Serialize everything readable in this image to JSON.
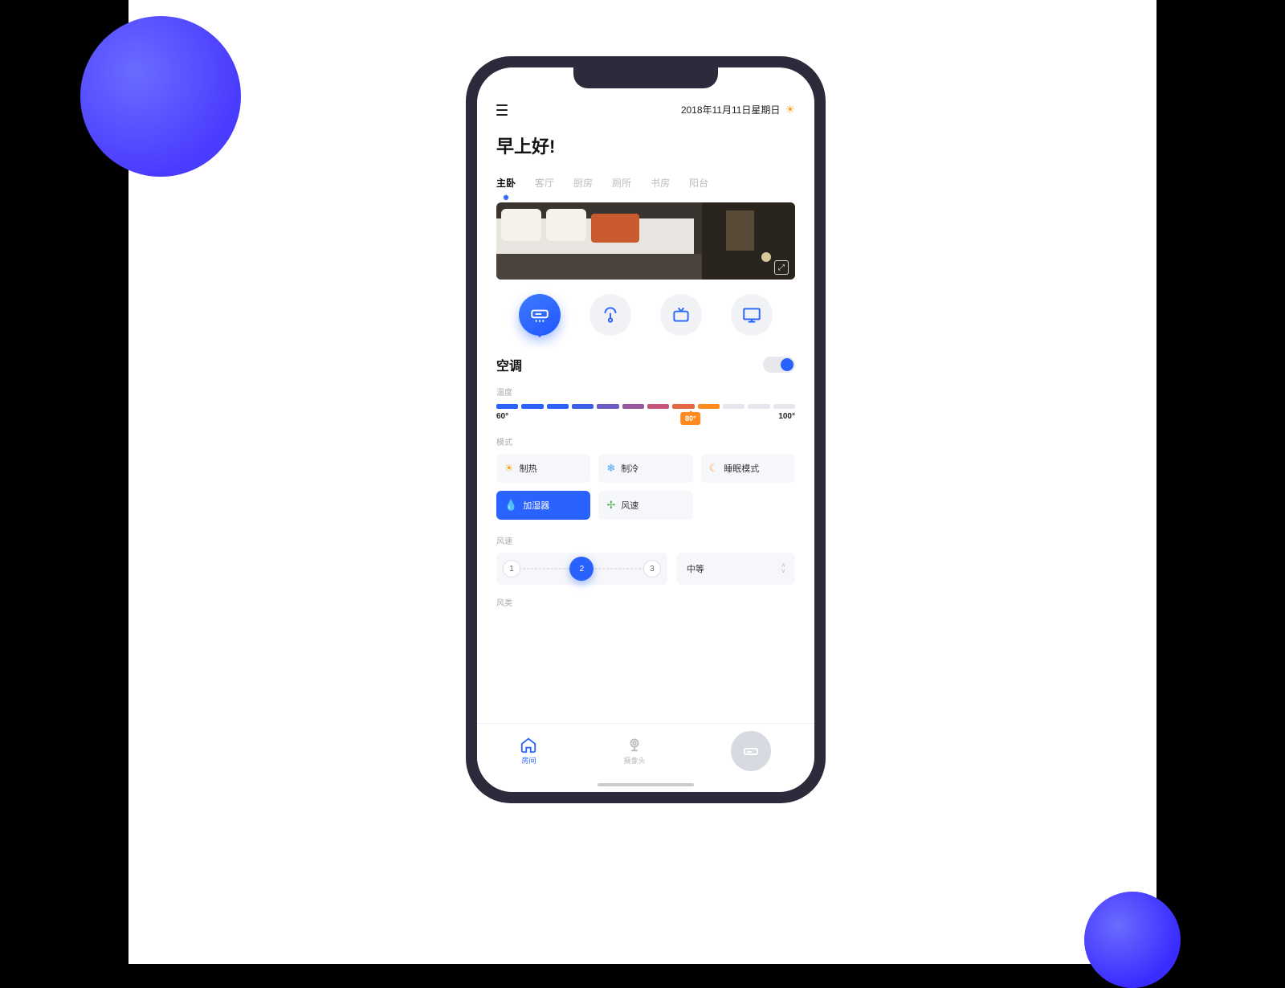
{
  "header": {
    "date": "2018年11月11日星期日"
  },
  "greeting": "早上好!",
  "rooms": {
    "tabs": [
      "主卧",
      "客厅",
      "厨房",
      "厕所",
      "书房",
      "阳台"
    ],
    "activeIndex": 0
  },
  "devices": {
    "items": [
      {
        "name": "ac",
        "icon": "ac-icon"
      },
      {
        "name": "lamp",
        "icon": "lamp-icon"
      },
      {
        "name": "tv",
        "icon": "tv-icon"
      },
      {
        "name": "monitor",
        "icon": "monitor-icon"
      }
    ],
    "activeIndex": 0
  },
  "ac": {
    "title": "空调",
    "power": true,
    "temperature": {
      "label": "温度",
      "min": "60°",
      "max": "100°",
      "value": "80°",
      "segColors": [
        "#2962ff",
        "#2962ff",
        "#2962ff",
        "#3b60e6",
        "#6a5cc4",
        "#9a58a0",
        "#c4547a",
        "#e36840",
        "#ff8a1e",
        "#e6e8ee",
        "#e6e8ee",
        "#e6e8ee"
      ]
    },
    "mode": {
      "label": "模式",
      "options": [
        {
          "label": "制热",
          "icon": "☀",
          "iconColor": "#f9a825",
          "active": false
        },
        {
          "label": "制冷",
          "icon": "❄",
          "iconColor": "#42a5f5",
          "active": false
        },
        {
          "label": "睡眠模式",
          "icon": "☾",
          "iconColor": "#f9a825",
          "active": false
        },
        {
          "label": "加湿器",
          "icon": "💧",
          "iconColor": "#ffffff",
          "active": true
        },
        {
          "label": "风速",
          "icon": "✢",
          "iconColor": "#4caf50",
          "active": false
        }
      ]
    },
    "fan": {
      "label": "风速",
      "steps": [
        "1",
        "2",
        "3"
      ],
      "activeStep": 1,
      "selectLabel": "中等"
    },
    "windType": {
      "label": "风类"
    }
  },
  "nav": {
    "items": [
      {
        "label": "房间",
        "active": true
      },
      {
        "label": "摄像头",
        "active": false
      }
    ]
  }
}
